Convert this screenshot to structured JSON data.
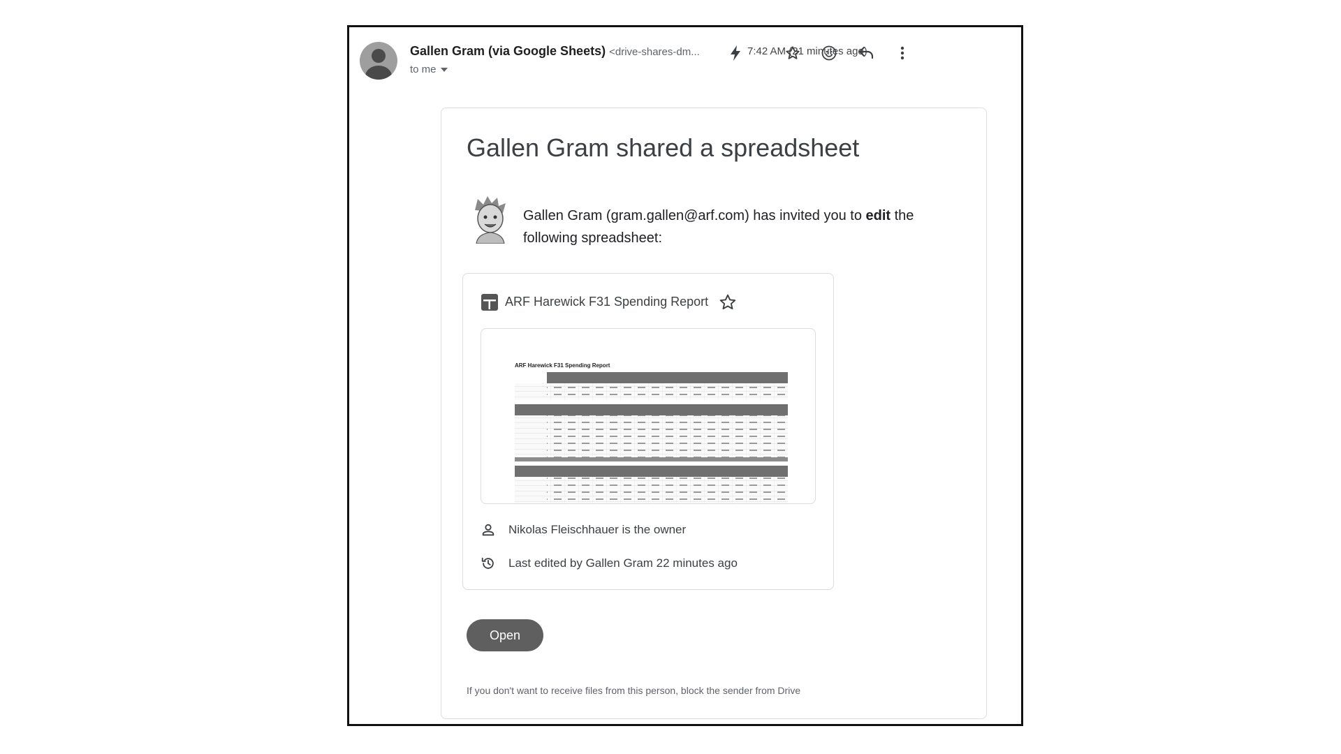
{
  "header": {
    "sender_name": "Gallen Gram (via Google Sheets)",
    "sender_email": "<drive-shares-dm...",
    "to_label": "to me",
    "timestamp": "7:42 AM (21 minutes ago)",
    "icons": [
      "avatar-icon",
      "lightning-icon",
      "star-icon",
      "emoji-icon",
      "reply-icon",
      "more-vert-icon"
    ]
  },
  "card": {
    "title": "Gallen Gram shared a spreadsheet",
    "invite_prefix": "Gallen Gram (gram.gallen@arf.com) has invited you to ",
    "invite_bold": "edit",
    "invite_suffix": " the following spreadsheet:",
    "file": {
      "name": "ARF Harewick F31 Spending Report",
      "preview_title": "ARF Harewick F31 Spending Report",
      "owner_text": "Nikolas Fleischhauer is the owner",
      "last_edited_text": "Last edited by Gallen Gram 22 minutes ago"
    },
    "open_label": "Open",
    "footer_note": "If you don't want to receive files from this person, block the sender from Drive"
  },
  "colors": {
    "button_bg": "#5f5f5f",
    "border": "#dadce0",
    "text_secondary": "#5f6368"
  }
}
